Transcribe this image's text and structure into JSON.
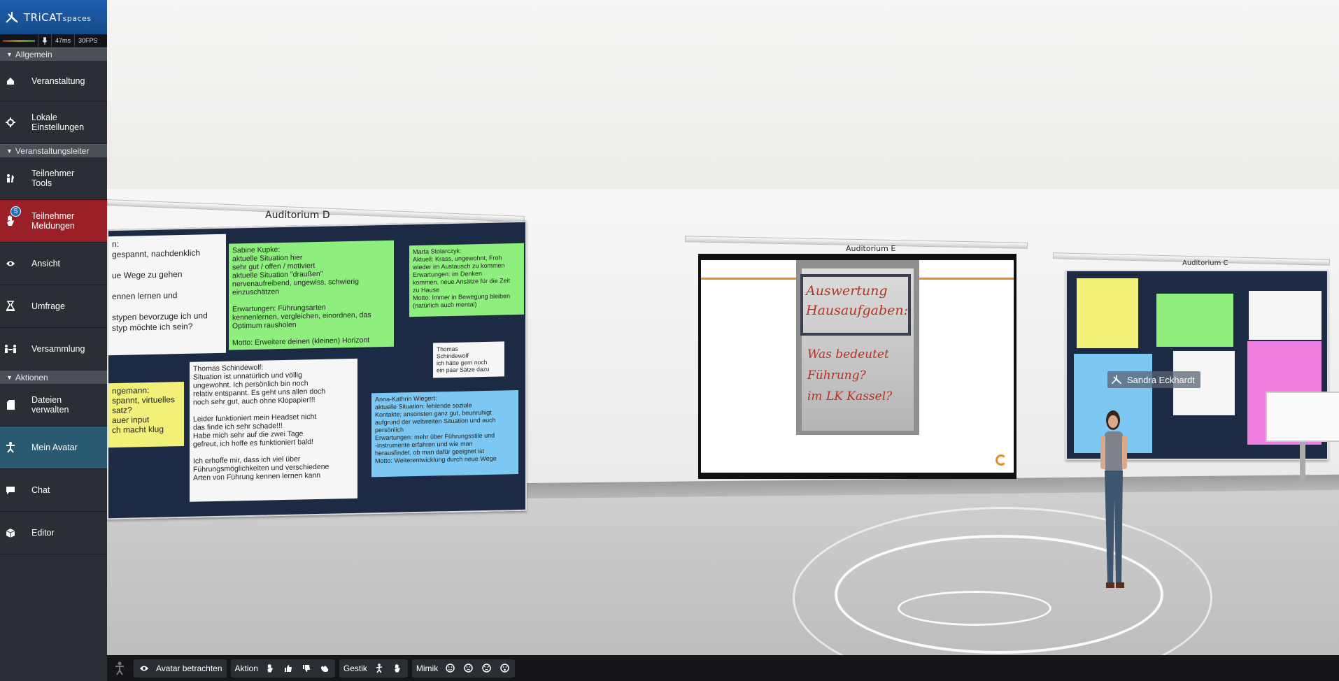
{
  "app": {
    "logo_main": "TRiCAT",
    "logo_sub": "spaces"
  },
  "status": {
    "ping": "47ms",
    "fps": "30FPS"
  },
  "sections": {
    "general": "Allgemein",
    "organizer": "Veranstaltungsleiter",
    "actions": "Aktionen"
  },
  "nav": {
    "event": "Veranstaltung",
    "local_settings": "Lokale\nEinstellungen",
    "participant_tools": "Teilnehmer\nTools",
    "participant_reports": "Teilnehmer\nMeldungen",
    "reports_badge": "5",
    "view": "Ansicht",
    "survey": "Umfrage",
    "assembly": "Versammlung",
    "manage_files": "Dateien\nverwalten",
    "my_avatar": "Mein Avatar",
    "chat": "Chat",
    "editor": "Editor"
  },
  "scene": {
    "auditorium_d": "Auditorium D",
    "auditorium_e": "Auditorium E",
    "auditorium_c": "Auditorium C",
    "avatar_name": "Sandra Eckhardt",
    "flip_line1": "Auswertung\nHausaufgaben:",
    "flip_line2": "Was bedeutet Führung?\nim LK Kassel?",
    "notes_d": {
      "left_white": "n:\ngespannt, nachdenklich\n\nue Wege zu gehen\n\nennen lernen und\n\nstypen bevorzuge ich und\nstyp möchte ich sein?",
      "sabine": "Sabine Kupke:\naktuelle Situation hier\nsehr gut / offen / motiviert\naktuelle Situation \"draußen\"\nnervenaufreibend, ungewiss, schwierig\neinzuschätzen\n\nErwartungen: Führungsarten\nkennenlernen, vergleichen, einordnen, das\nOptimum rausholen\n\nMotto: Erweitere deinen (kleinen) Horizont",
      "marta": "Marta Stolarczyk:\nAktuell: Krass, ungewohnt, Froh\nwieder im Austausch zu kommen\nErwartungen: im Denken\nkommen, neue Ansätze für die Zeit\nzu Hause\nMotto: Immer in Bewegung bleiben\n(natürlich auch mental)",
      "thomas": "Thomas Schindewolf:\nSituation ist unnatürlich und völlig\nungewohnt. Ich persönlich bin noch\nrelativ entspannt. Es geht uns allen doch\nnoch sehr gut, auch ohne Klopapier!!!\n\nLeider funktioniert mein Headset nicht\ndas finde ich sehr schade!!!\nHabe mich sehr auf die zwei Tage\ngefreut, ich hoffe es funktioniert bald!\n\nIch erhoffe mir, dass ich viel über\nFührungsmöglichkeiten und verschiedene\nArten von Führung kennen lernen kann",
      "thomas_small": "Thomas\nSchindewolf\nich hätte gern noch\nein paar Sätze dazu",
      "left_yellow": "ngemann:\nspannt, virtuelles\nsatz?\nauer input\nch macht klug",
      "anna": "Anna-Kathrin Wiegert:\naktuelle Situation: fehlende soziale\nKontakte; ansonsten ganz gut, beunruhigt\naufgrund der weltweiten Situation und auch\npersönlich\nErwartungen: mehr über Führungsstile und\n-instrumente erfahren und wie man\nherausfindet, ob man dafür geeignet ist\nMotto: Weiterentwicklung durch neue Wege"
    }
  },
  "toolbar": {
    "view_avatar": "Avatar betrachten",
    "action": "Aktion",
    "gesture": "Gestik",
    "mimic": "Mimik"
  },
  "colors": {
    "sidebar_bg": "#2a2d33",
    "logo_blue": "#1f5fae",
    "active_red": "#9b1f27",
    "active_teal": "#2a5a72",
    "badge_blue": "#1e73be"
  }
}
